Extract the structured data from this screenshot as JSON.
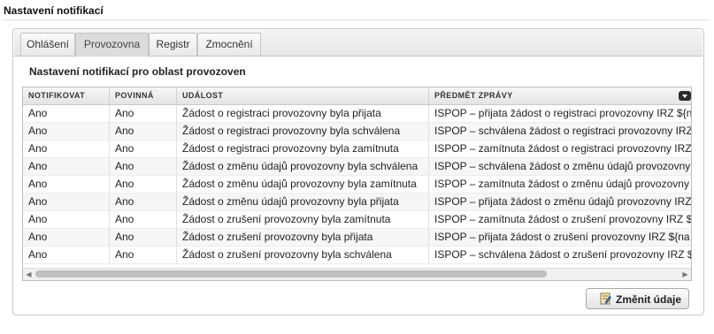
{
  "page": {
    "title": "Nastavení notifikací"
  },
  "tabs": [
    {
      "label": "Ohlášení"
    },
    {
      "label": "Provozovna"
    },
    {
      "label": "Registr"
    },
    {
      "label": "Zmocnění"
    }
  ],
  "active_tab": "Provozovna",
  "section": {
    "title": "Nastavení notifikací pro oblast provozoven"
  },
  "grid": {
    "columns": [
      "NOTIFIKOVAT",
      "POVINNÁ",
      "UDÁLOST",
      "PŘEDMĚT ZPRÁVY"
    ],
    "rows": [
      [
        "Ano",
        "Ano",
        "Žádost o registraci provozovny byla přijata",
        "ISPOP – přijata žádost o registraci provozovny IRZ ${n"
      ],
      [
        "Ano",
        "Ano",
        "Žádost o registraci provozovny byla schválena",
        "ISPOP – schválena žádost o registraci provozovny IRZ"
      ],
      [
        "Ano",
        "Ano",
        "Žádost o registraci provozovny byla zamítnuta",
        "ISPOP – zamítnuta žádost o registraci provozovny IRZ"
      ],
      [
        "Ano",
        "Ano",
        "Žádost o změnu údajů provozovny byla schválena",
        "ISPOP – schválena žádost o změnu údajů provozovny"
      ],
      [
        "Ano",
        "Ano",
        "Žádost o změnu údajů provozovny byla zamítnuta",
        "ISPOP – zamítnuta žádost o změnu údajů provozovny"
      ],
      [
        "Ano",
        "Ano",
        "Žádost o změnu údajů provozovny byla přijata",
        "ISPOP – přijata žádost o změnu údajů provozovny IRZ"
      ],
      [
        "Ano",
        "Ano",
        "Žádost o zrušení provozovny byla zamítnuta",
        "ISPOP – zamítnuta žádost o zrušení provozovny IRZ $"
      ],
      [
        "Ano",
        "Ano",
        "Žádost o zrušení provozovny byla přijata",
        "ISPOP – přijata žádost o zrušení provozovny IRZ ${na"
      ],
      [
        "Ano",
        "Ano",
        "Žádost o zrušení provozovny byla schválena",
        "ISPOP – schválena žádost o zrušení provozovny IRZ $"
      ]
    ]
  },
  "actions": {
    "edit_label": "Změnit údaje",
    "edit_icon": "edit-document-icon"
  },
  "colors": {
    "active_tab_bg": "#dcdcdc",
    "sort_button": "#2d2d2d"
  }
}
